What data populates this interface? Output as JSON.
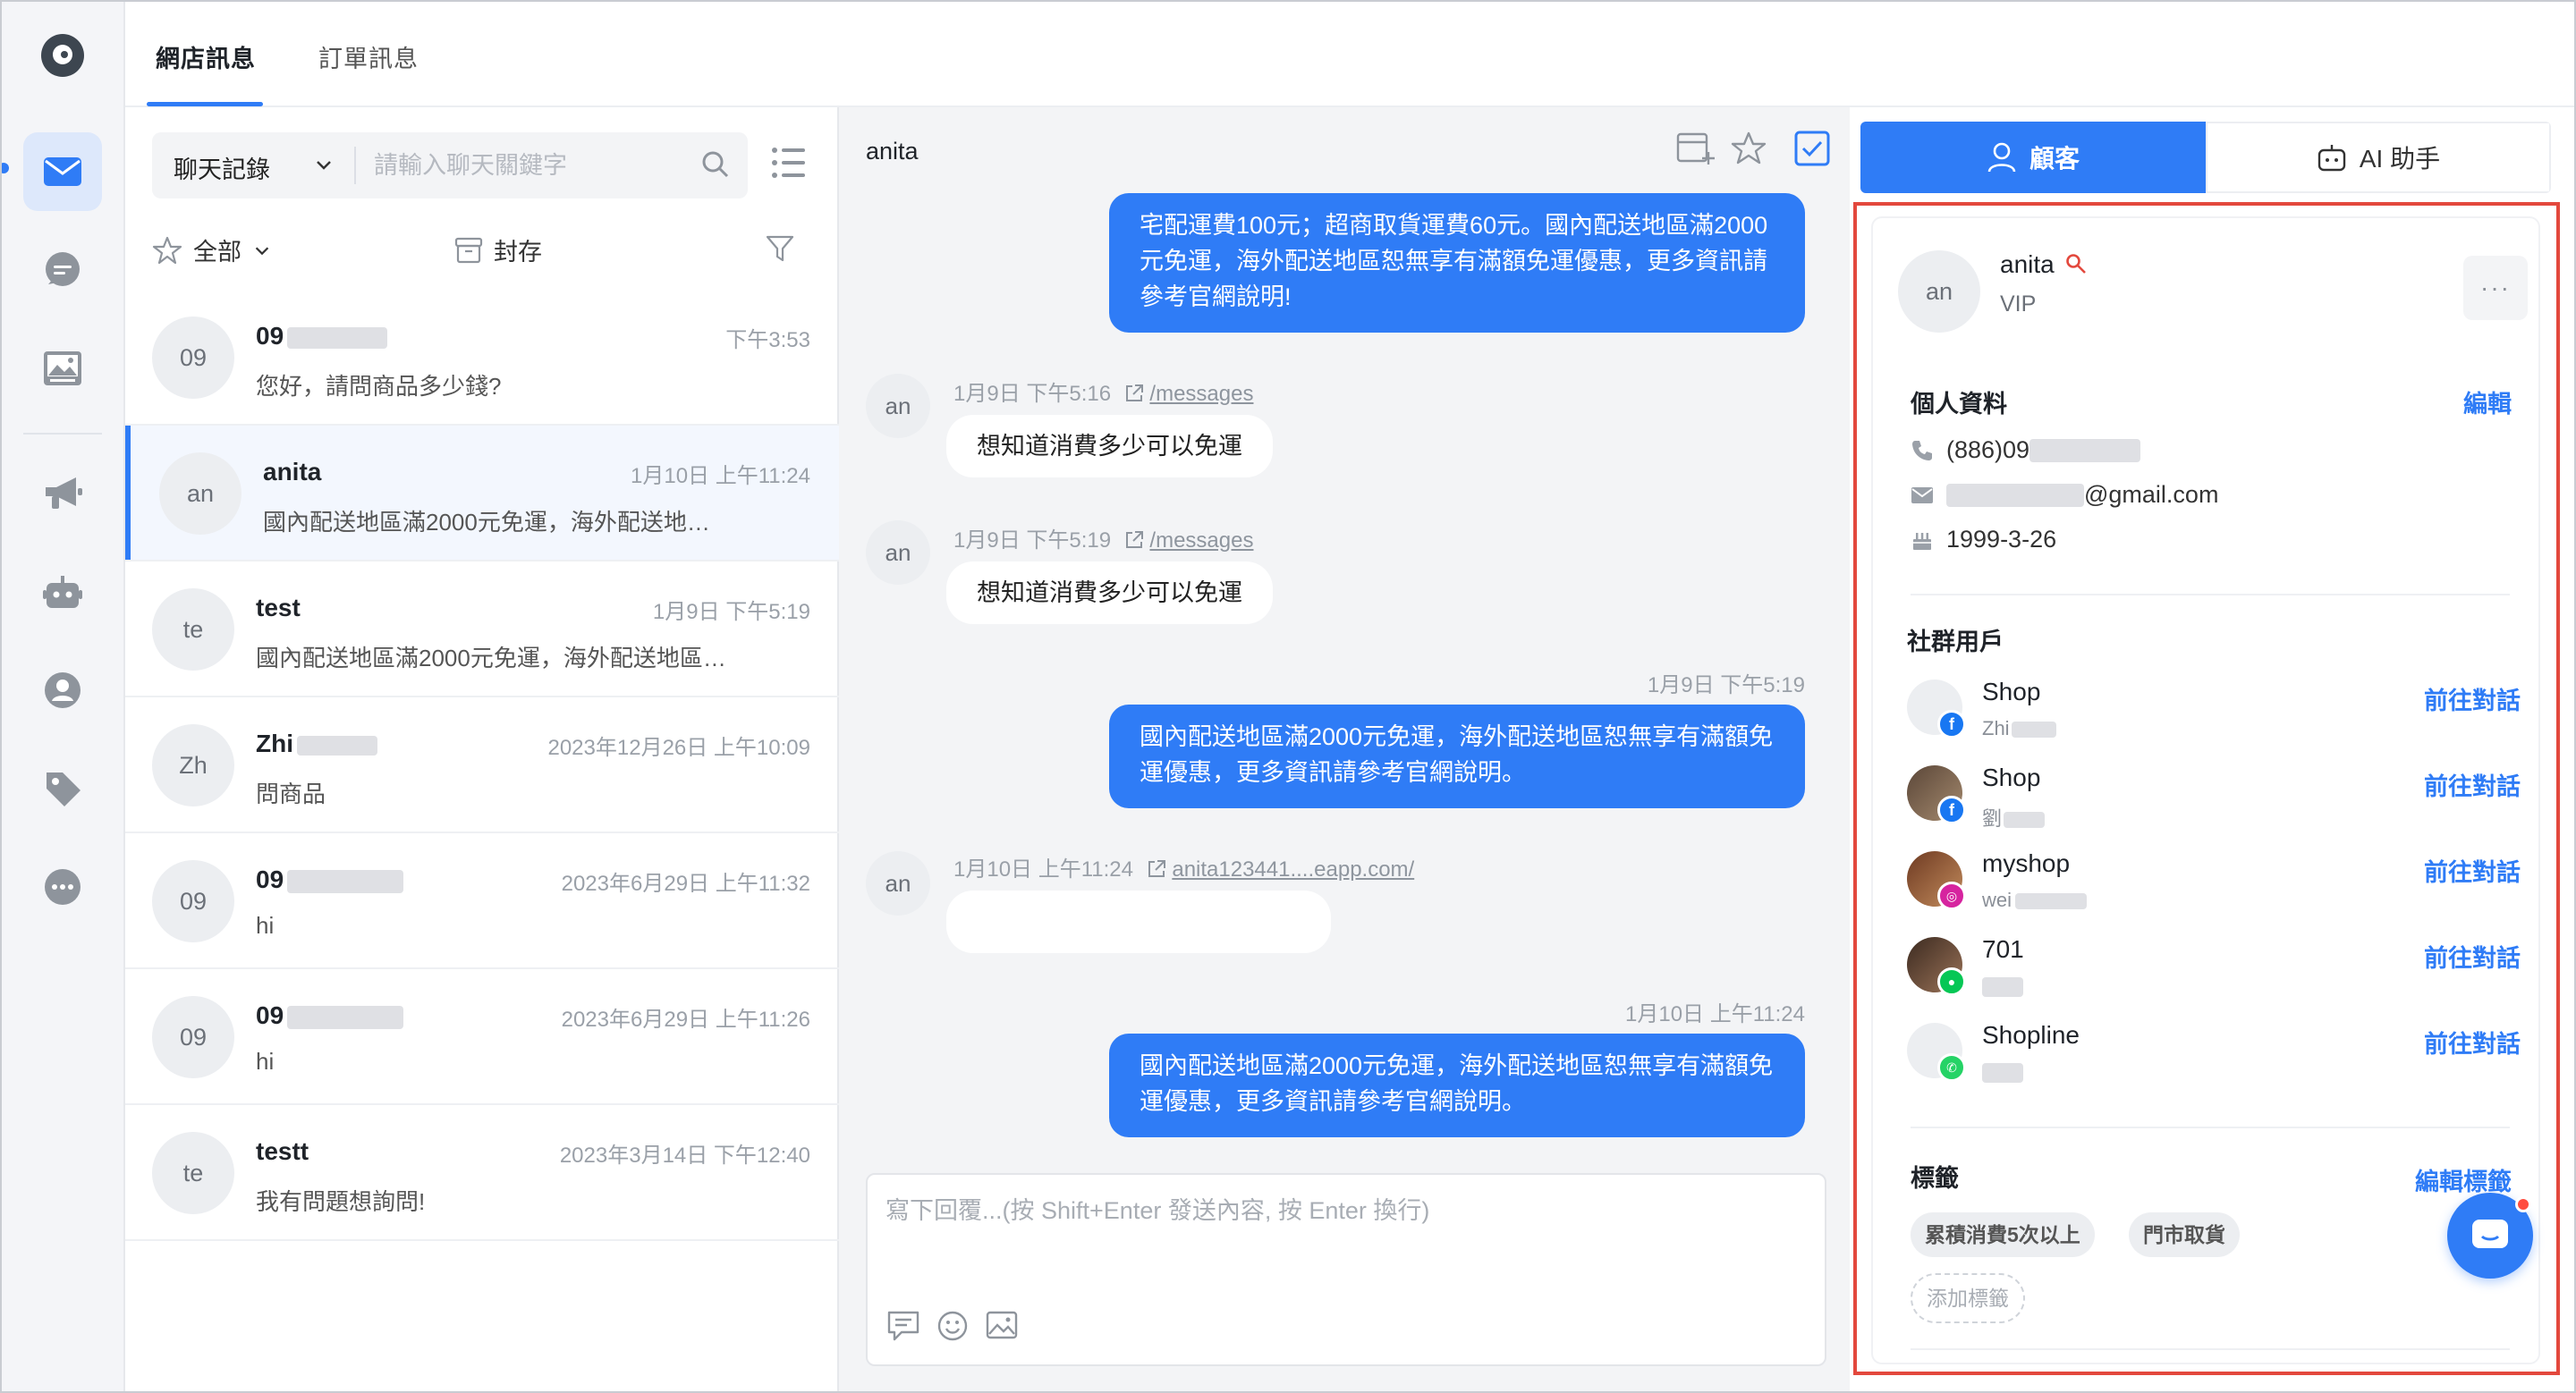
{
  "top_tabs": [
    {
      "label": "網店訊息",
      "active": true
    },
    {
      "label": "訂單訊息",
      "active": false
    }
  ],
  "rail_icons": [
    "mail-icon",
    "chat-bubble-icon",
    "image-icon",
    "megaphone-icon",
    "robot-icon",
    "support-agent-icon",
    "tag-icon",
    "more-dots-icon"
  ],
  "conversation_list": {
    "search_scope": "聊天記錄",
    "search_placeholder": "請輸入聊天關鍵字",
    "filter_all": "全部",
    "filter_archive": "封存",
    "items": [
      {
        "avatar": "09",
        "name": "09",
        "time": "下午3:53",
        "message": "您好，請問商品多少錢?",
        "active": false
      },
      {
        "avatar": "an",
        "name": "anita",
        "time": "1月10日 上午11:24",
        "message": "國內配送地區滿2000元免運，海外配送地…",
        "active": true
      },
      {
        "avatar": "te",
        "name": "test",
        "time": "1月9日 下午5:19",
        "message": "國內配送地區滿2000元免運，海外配送地區…",
        "active": false
      },
      {
        "avatar": "Zh",
        "name": "Zhi",
        "time": "2023年12月26日 上午10:09",
        "message": "問商品",
        "active": false
      },
      {
        "avatar": "09",
        "name": "09",
        "time": "2023年6月29日 上午11:32",
        "message": "hi",
        "active": false
      },
      {
        "avatar": "09",
        "name": "09",
        "time": "2023年6月29日 上午11:26",
        "message": "hi",
        "active": false
      },
      {
        "avatar": "te",
        "name": "testt",
        "time": "2023年3月14日 下午12:40",
        "message": "我有問題想詢問!",
        "active": false
      }
    ]
  },
  "chat": {
    "contact_name": "anita",
    "avatar": "an",
    "messages": [
      {
        "dir": "out",
        "lines": [
          "宅配運費100元；超商取貨運費60元。國內配送地區滿2000",
          "元免運，海外配送地區恕無享有滿額免運優惠，更多資訊請",
          "參考官網說明!"
        ]
      },
      {
        "dir": "in",
        "time": "1月9日 下午5:16",
        "link": "/messages",
        "text": "想知道消費多少可以免運"
      },
      {
        "dir": "in",
        "time": "1月9日 下午5:19",
        "link": "/messages",
        "text": "想知道消費多少可以免運"
      },
      {
        "dir": "out",
        "time": "1月9日 下午5:19",
        "lines": [
          "國內配送地區滿2000元免運，海外配送地區恕無享有滿額免",
          "運優惠，更多資訊請參考官網說明。"
        ]
      },
      {
        "dir": "in",
        "time": "1月10日 上午11:24",
        "link": "anita123441....eapp.com/",
        "text": ""
      },
      {
        "dir": "out",
        "time": "1月10日 上午11:24",
        "lines": [
          "國內配送地區滿2000元免運，海外配送地區恕無享有滿額免",
          "運優惠，更多資訊請參考官網說明。"
        ]
      }
    ],
    "composer_placeholder": "寫下回覆...(按 Shift+Enter 發送內容, 按 Enter 換行)"
  },
  "right_panel": {
    "tab_customer": "顧客",
    "tab_ai": "AI 助手",
    "customer": {
      "avatar": "an",
      "name": "anita",
      "tier": "VIP",
      "profile_title": "個人資料",
      "edit_label": "編輯",
      "phone": "(886)09",
      "email_suffix": "@gmail.com",
      "birthday": "1999-3-26",
      "more": "···"
    },
    "social_title": "社群用戶",
    "social_users": [
      {
        "name": "Shop",
        "sub": "Zhi",
        "platform": "facebook",
        "action": "前往對話"
      },
      {
        "name": "Shop",
        "sub": "劉",
        "platform": "facebook",
        "action": "前往對話"
      },
      {
        "name": "myshop",
        "sub": "wei",
        "platform": "instagram",
        "action": "前往對話"
      },
      {
        "name": "701",
        "sub": "",
        "platform": "line",
        "action": "前往對話"
      },
      {
        "name": "Shopline",
        "sub": "",
        "platform": "whatsapp",
        "action": "前往對話"
      }
    ],
    "tags_title": "標籤",
    "edit_tags_label": "編輯標籤",
    "tags": [
      "累積消費5次以上",
      "門市取貨"
    ],
    "add_tag_label": "添加標籤"
  },
  "colors": {
    "accent": "#2f7cf6",
    "highlight_border": "#e3483d",
    "chat_bg": "#f3f4f6",
    "facebook": "#1877f2",
    "instagram": "#d6249f",
    "line": "#06c755",
    "whatsapp": "#25d366"
  }
}
